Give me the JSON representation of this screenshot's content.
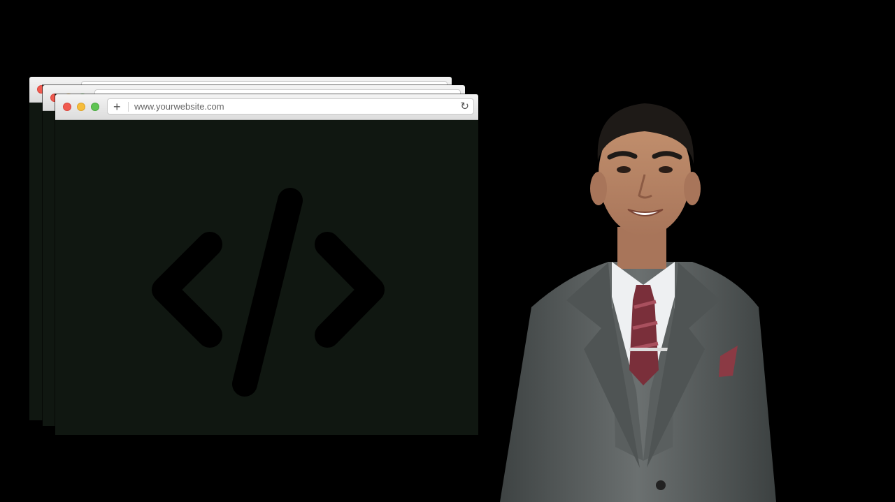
{
  "browser": {
    "url": "www.yourwebsite.com",
    "plus_glyph": "+",
    "reload_glyph": "↻"
  },
  "icons": {
    "center": "code-icon",
    "new_tab": "plus-icon",
    "reload": "reload-icon"
  },
  "colors": {
    "background": "#000000",
    "browser_content": "#101711",
    "traffic_red": "#f05a4f",
    "traffic_yellow": "#f6bd3b",
    "traffic_green": "#5fc453"
  }
}
